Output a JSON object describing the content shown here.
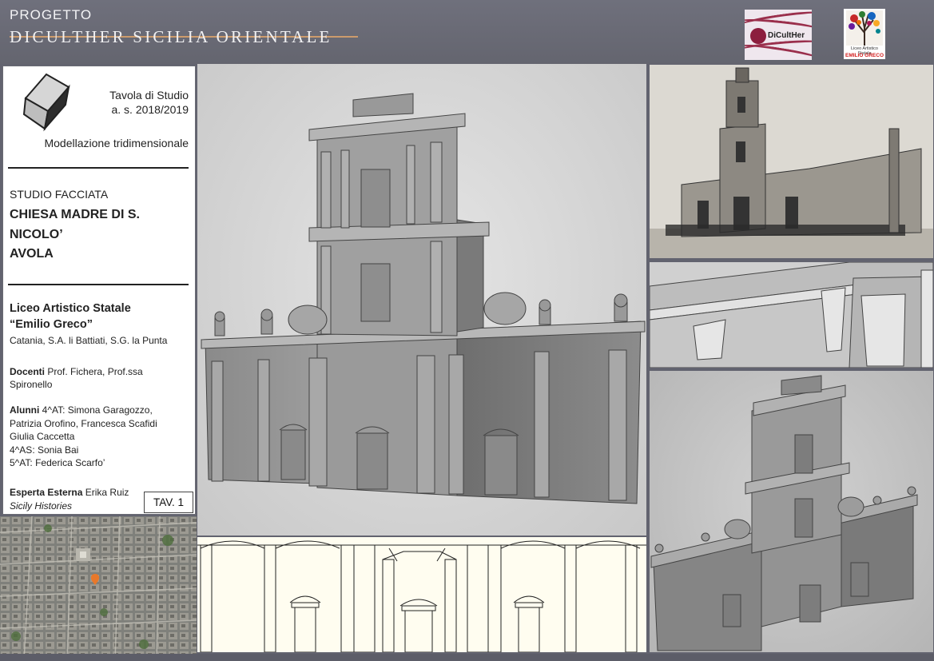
{
  "header": {
    "project_label": "PROGETTO",
    "project_name": "DICULTHER SICILIA ORIENTALE",
    "logo_diculther_text": "DiCultHer",
    "logo_school_line1": "Liceo Artistico Statale",
    "logo_school_line2": "EMILIO GRECO"
  },
  "info": {
    "tavola_line1": "Tavola di Studio",
    "tavola_line2": "a. s. 2018/2019",
    "modellazione": "Modellazione tridimensionale",
    "studio": "STUDIO FACCIATA",
    "chiesa_line1": "CHIESA MADRE DI S.",
    "chiesa_line2": "NICOLO’",
    "chiesa_line3": "AVOLA",
    "liceo": "Liceo Artistico Statale",
    "emilio": "“Emilio Greco”",
    "catania": "Catania, S.A. li Battiati, S.G. la Punta",
    "docenti_label": "Docenti",
    "docenti_names": " Prof. Fichera, Prof.ssa Spironello",
    "alunni_label": "Alunni",
    "alunni_line1": " 4^AT: Simona Garagozzo,",
    "alunni_line2": "Patrizia Orofino, Francesca Scafidi",
    "alunni_line3": "Giulia Caccetta",
    "alunni_line4": "4^AS: Sonia Bai",
    "alunni_line5": "5^AT: Federica Scarfo’",
    "esperta_label": "Esperta Esterna",
    "esperta_name": " Erika Ruiz",
    "sicily": "Sicily Histories",
    "tav": "TAV. 1"
  },
  "colors": {
    "background": "#62636f",
    "accent_line": "#d7a16c",
    "map_marker": "#e8782a"
  }
}
